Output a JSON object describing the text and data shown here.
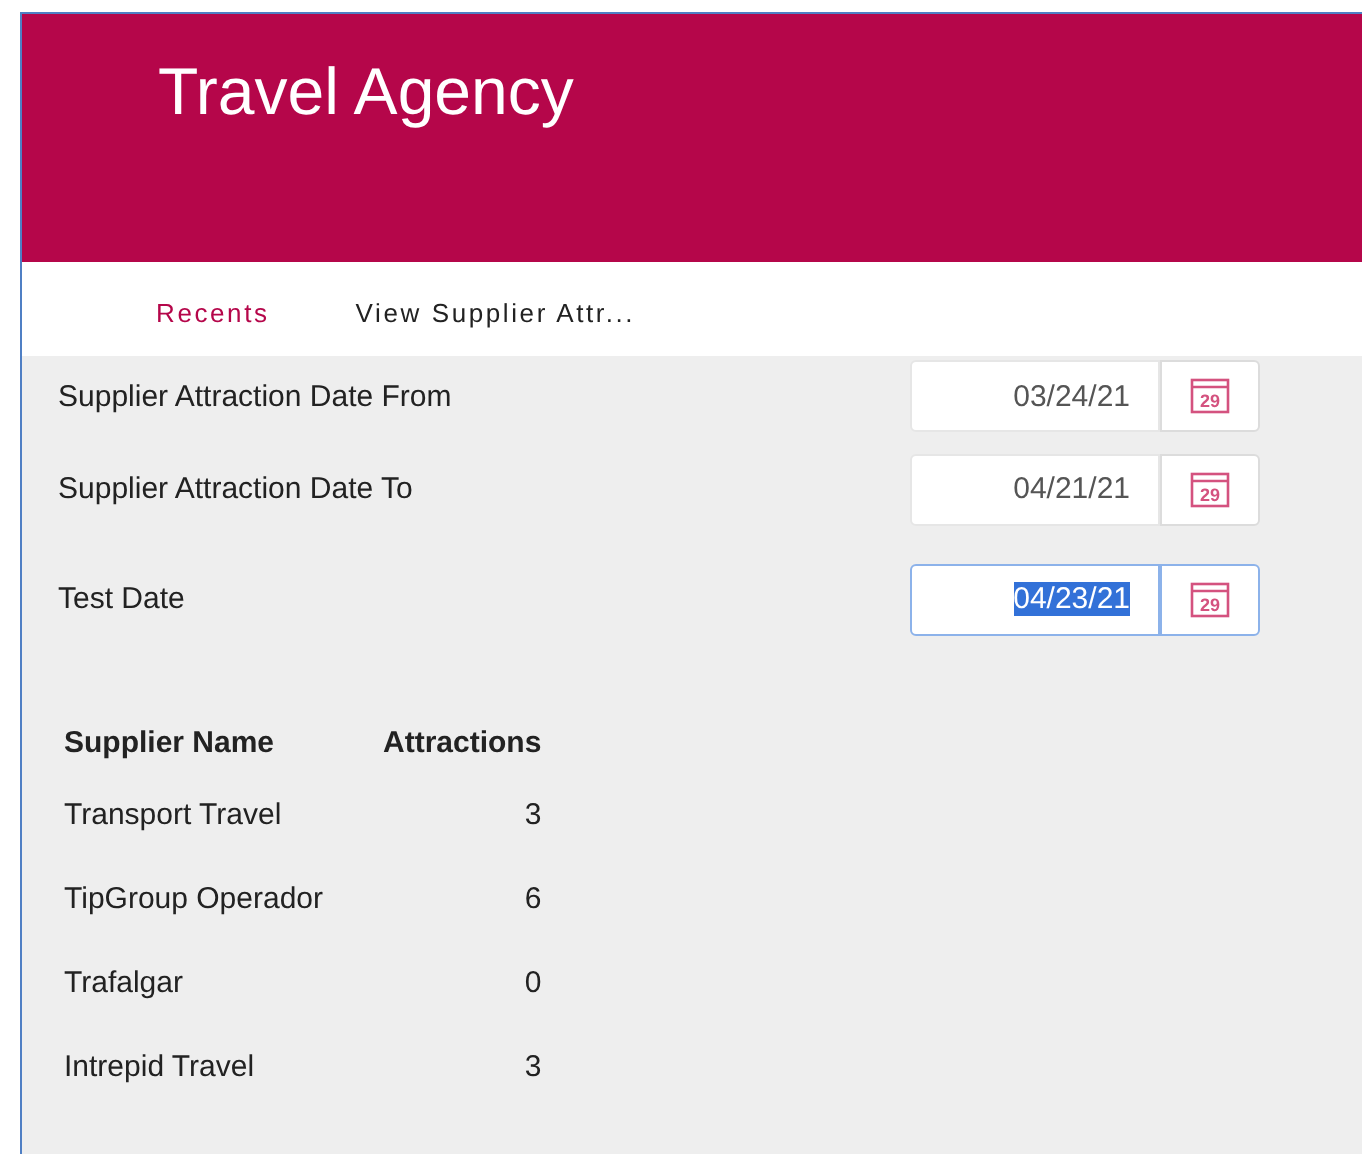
{
  "header": {
    "title": "Travel Agency"
  },
  "nav": {
    "tabs": [
      {
        "label": "Recents",
        "selected": true
      },
      {
        "label": "View Supplier Attr...",
        "selected": false
      }
    ]
  },
  "filters": [
    {
      "label": "Supplier Attraction Date From",
      "value": "03/24/21",
      "focused": false,
      "calendar_day": "29"
    },
    {
      "label": "Supplier Attraction Date To",
      "value": "04/21/21",
      "focused": false,
      "calendar_day": "29"
    },
    {
      "label": "Test Date",
      "value": "04/23/21",
      "focused": true,
      "calendar_day": "29"
    }
  ],
  "table": {
    "columns": [
      "Supplier Name",
      "Attractions"
    ],
    "rows": [
      [
        "Transport Travel",
        "3"
      ],
      [
        "TipGroup Operador",
        "6"
      ],
      [
        "Trafalgar",
        "0"
      ],
      [
        "Intrepid Travel",
        "3"
      ]
    ]
  }
}
